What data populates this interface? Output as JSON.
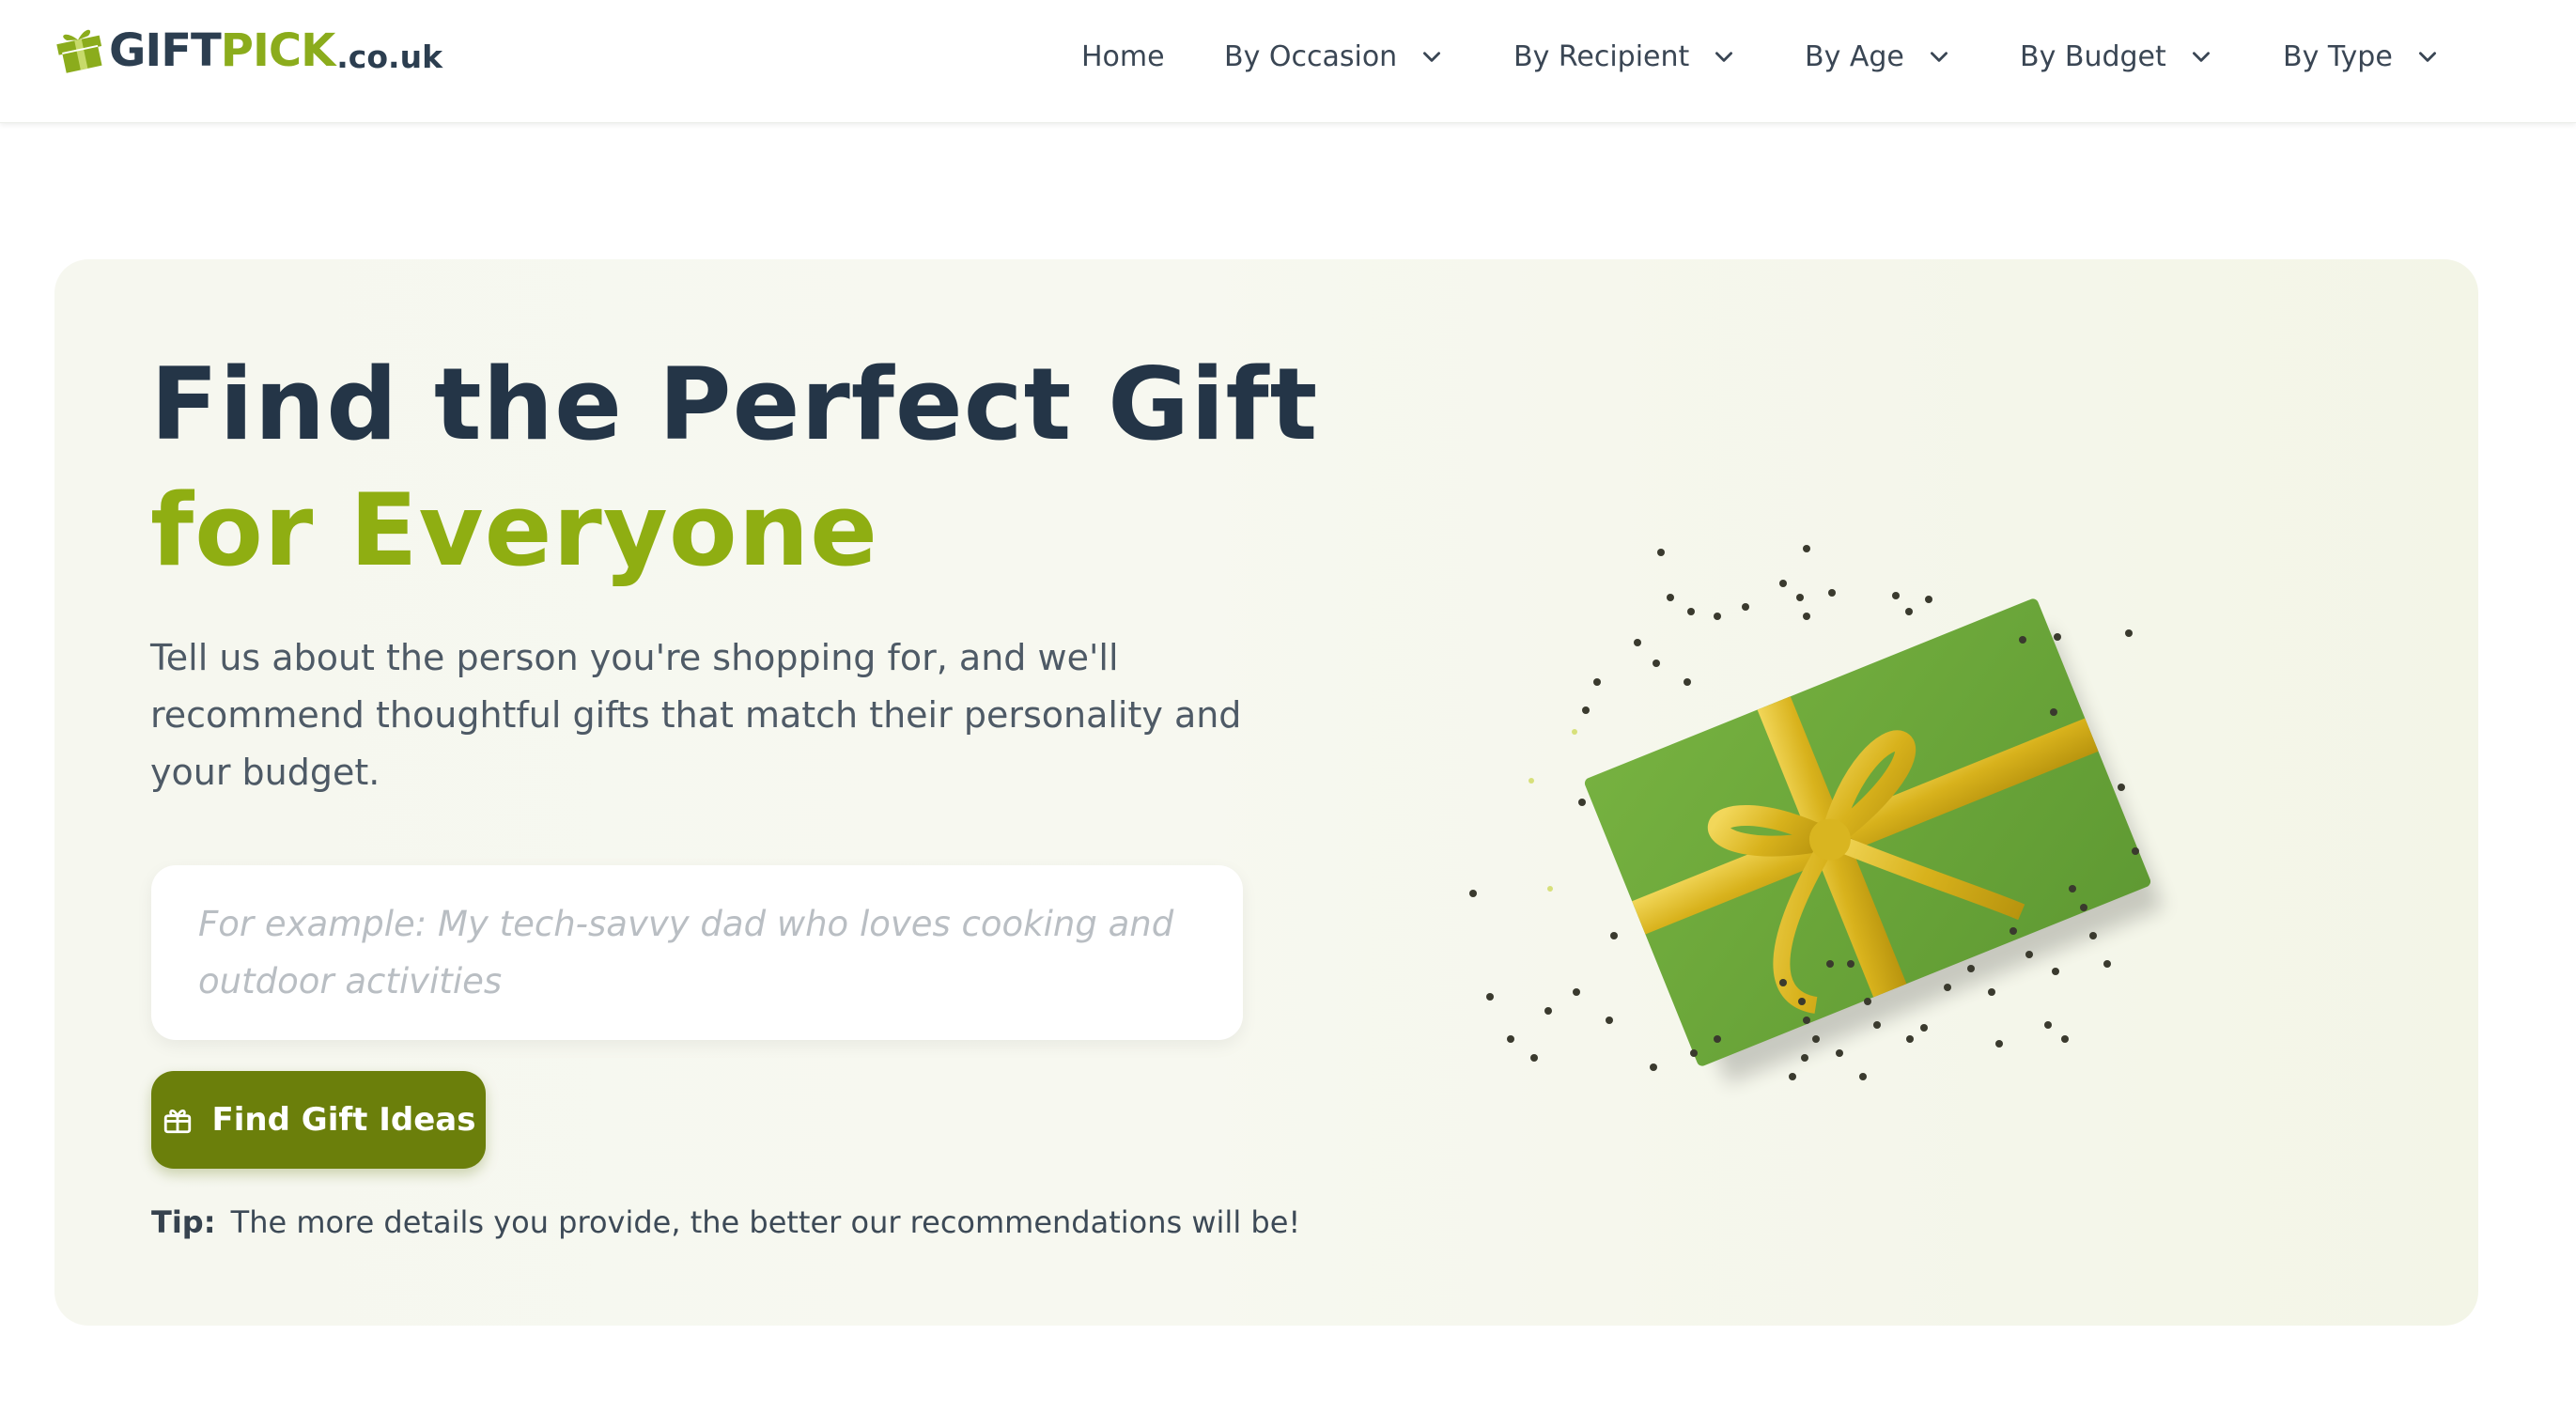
{
  "brand": {
    "name_part1": "GIFT",
    "name_part2": "PICK",
    "tld": ".co.uk",
    "logo_icon": "gift-box-icon",
    "colors": {
      "dark": "#2c3e50",
      "green": "#8bac1c"
    }
  },
  "nav": {
    "items": [
      {
        "label": "Home",
        "has_dropdown": false
      },
      {
        "label": "By Occasion",
        "has_dropdown": true,
        "icon": "chevron-down-icon"
      },
      {
        "label": "By Recipient",
        "has_dropdown": true,
        "icon": "chevron-down-icon"
      },
      {
        "label": "By Age",
        "has_dropdown": true,
        "icon": "chevron-down-icon"
      },
      {
        "label": "By Budget",
        "has_dropdown": true,
        "icon": "chevron-down-icon"
      },
      {
        "label": "By Type",
        "has_dropdown": true,
        "icon": "chevron-down-icon"
      }
    ]
  },
  "hero": {
    "title_line1": "Find the Perfect Gift",
    "title_line2": "for Everyone",
    "description": "Tell us about the person you're shopping for, and we'll recommend thoughtful gifts that match their personality and your budget.",
    "input": {
      "value": "",
      "placeholder": "For example: My tech-savvy dad who loves cooking and outdoor activities"
    },
    "cta": {
      "label": "Find Gift Ideas",
      "icon": "gift-icon"
    },
    "tip_label": "Tip:",
    "tip_text": "The more details you provide, the better our recommendations will be!",
    "illustration": "wrapped-gift-with-gold-ribbon",
    "colors": {
      "accent": "#8fae12",
      "button": "#6b7f0b",
      "panel": "#f6f7ef"
    }
  }
}
